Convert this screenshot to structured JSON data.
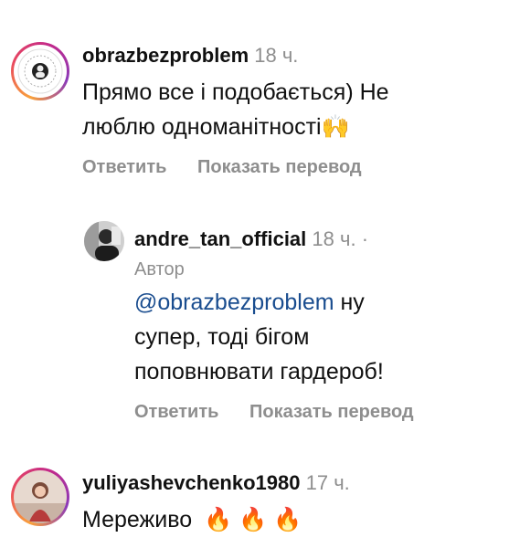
{
  "comments": [
    {
      "username": "obrazbezproblem",
      "time": "18 ч.",
      "text_line1": "Прямо все і подобається) Не",
      "text_line2": "люблю одноманітності",
      "emoji": "🙌",
      "reply_label": "Ответить",
      "translate_label": "Показать перевод"
    },
    {
      "username": "andre_tan_official",
      "time": "18 ч.",
      "dot": "·",
      "author_badge": "Автор",
      "mention": "@obrazbezproblem",
      "text_after_mention": "ну",
      "text_line2": "супер, тоді бігом",
      "text_line3": "поповнювати гардероб!",
      "reply_label": "Ответить",
      "translate_label": "Показать перевод"
    },
    {
      "username": "yuliyashevchenko1980",
      "time": "17 ч.",
      "text": "Мереживо",
      "emojis": "🔥 🔥 🔥"
    }
  ],
  "colors": {
    "secondary_text": "#8e8e8e",
    "mention": "#1a4d8f",
    "story_ring": "#e8475f"
  }
}
